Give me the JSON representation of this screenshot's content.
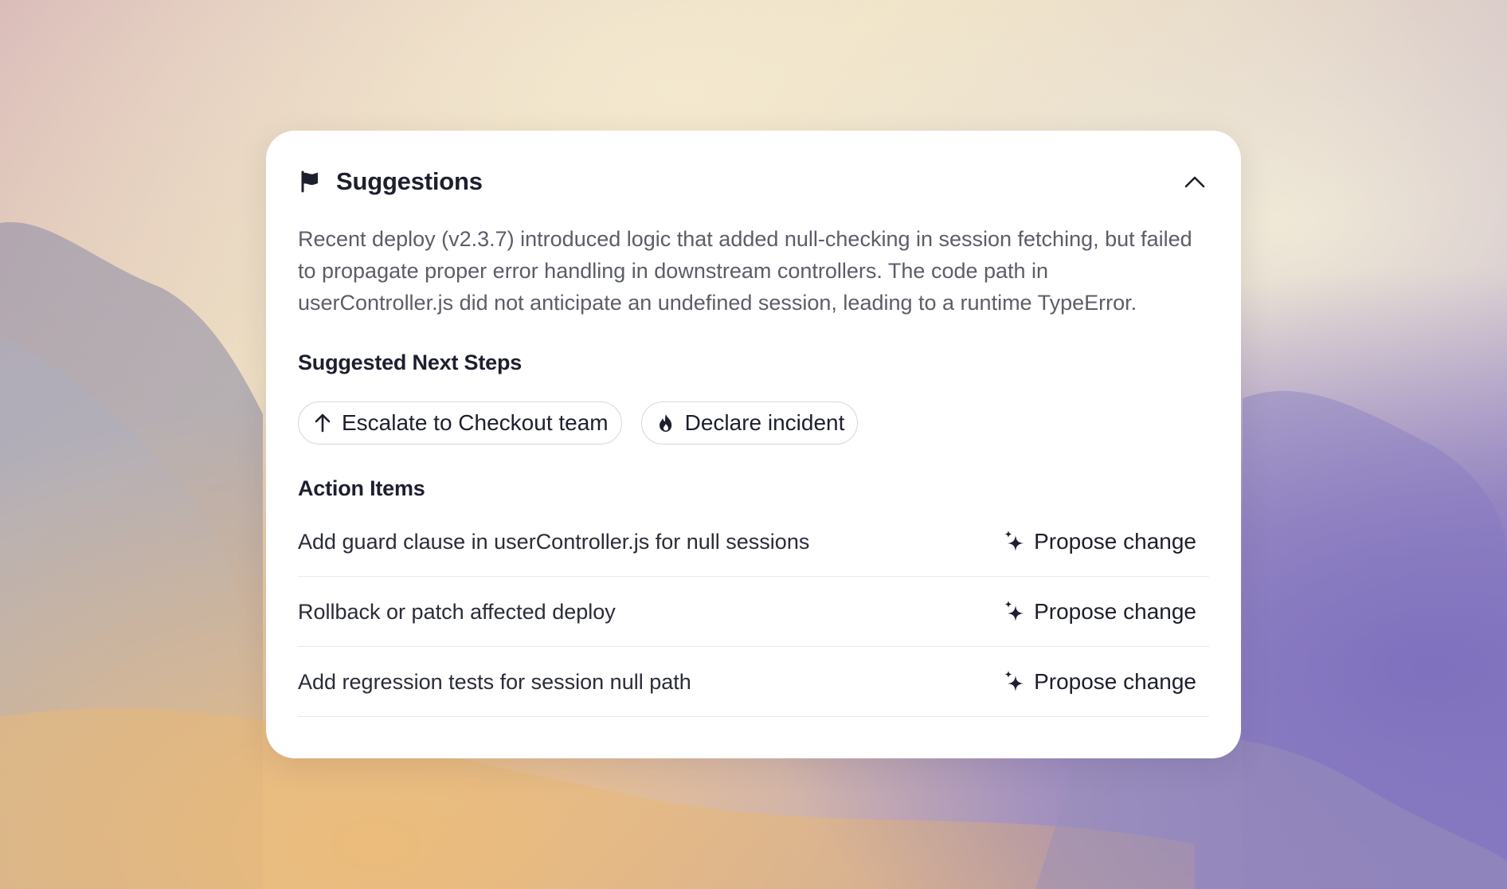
{
  "card": {
    "title": "Suggestions",
    "summary": "Recent deploy (v2.3.7) introduced logic that added null-checking in session fetching, but failed to propagate proper error handling in downstream controllers. The code path in userController.js did not anticipate an undefined session, leading to a runtime TypeError."
  },
  "next_steps": {
    "heading": "Suggested Next Steps",
    "chips": [
      {
        "label": "Escalate to Checkout team",
        "icon": "arrow-up-icon"
      },
      {
        "label": "Declare incident",
        "icon": "flame-icon"
      }
    ]
  },
  "action_items": {
    "heading": "Action Items",
    "items": [
      {
        "text": "Add guard clause in userController.js for null sessions",
        "action": "Propose change",
        "icon": "sparkle-icon"
      },
      {
        "text": "Rollback or patch affected deploy",
        "action": "Propose change",
        "icon": "sparkle-icon"
      },
      {
        "text": "Add regression tests for session null path",
        "action": "Propose change",
        "icon": "sparkle-icon"
      }
    ]
  },
  "colors": {
    "text_primary": "#1d1f2e",
    "text_secondary": "#5b5d68",
    "card_bg": "#ffffff",
    "divider": "#e8e8ec"
  }
}
